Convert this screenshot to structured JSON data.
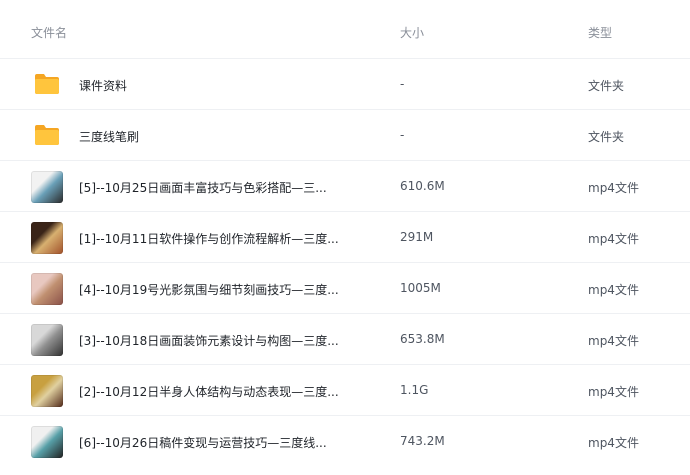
{
  "header": {
    "name": "文件名",
    "size": "大小",
    "type": "类型"
  },
  "files": [
    {
      "kind": "folder",
      "name": "课件资料",
      "size": "-",
      "type": "文件夹",
      "icon": "folder-icon"
    },
    {
      "kind": "folder",
      "name": "三度线笔刷",
      "size": "-",
      "type": "文件夹",
      "icon": "folder-icon"
    },
    {
      "kind": "video",
      "name": "[5]--10月25日画面丰富技巧与色彩搭配—三...",
      "size": "610.6M",
      "type": "mp4文件",
      "icon": "video-thumbnail",
      "colors": [
        "#f2f2f2",
        "#2a2a2a",
        "#6aa0b8"
      ]
    },
    {
      "kind": "video",
      "name": "[1]--10月11日软件操作与创作流程解析—三度...",
      "size": "291M",
      "type": "mp4文件",
      "icon": "video-thumbnail",
      "colors": [
        "#3a2418",
        "#a0502a",
        "#d8b070"
      ]
    },
    {
      "kind": "video",
      "name": "[4]--10月19号光影氛围与细节刻画技巧—三度...",
      "size": "1005M",
      "type": "mp4文件",
      "icon": "video-thumbnail",
      "colors": [
        "#e8c8c0",
        "#8a5048",
        "#c09070"
      ]
    },
    {
      "kind": "video",
      "name": "[3]--10月18日画面装饰元素设计与构图—三度...",
      "size": "653.8M",
      "type": "mp4文件",
      "icon": "video-thumbnail",
      "colors": [
        "#d8d8d8",
        "#303030",
        "#909090"
      ]
    },
    {
      "kind": "video",
      "name": "[2]--10月12日半身人体结构与动态表现—三度...",
      "size": "1.1G",
      "type": "mp4文件",
      "icon": "video-thumbnail",
      "colors": [
        "#c8a040",
        "#502818",
        "#e0d0a0"
      ]
    },
    {
      "kind": "video",
      "name": "[6]--10月26日稿件变现与运营技巧—三度线...",
      "size": "743.2M",
      "type": "mp4文件",
      "icon": "video-thumbnail",
      "colors": [
        "#f0f0f0",
        "#202020",
        "#58a0a8"
      ]
    }
  ],
  "colors": {
    "folder": "#ffc53d",
    "folder_dark": "#f5a623",
    "divider": "#eef0f3"
  }
}
